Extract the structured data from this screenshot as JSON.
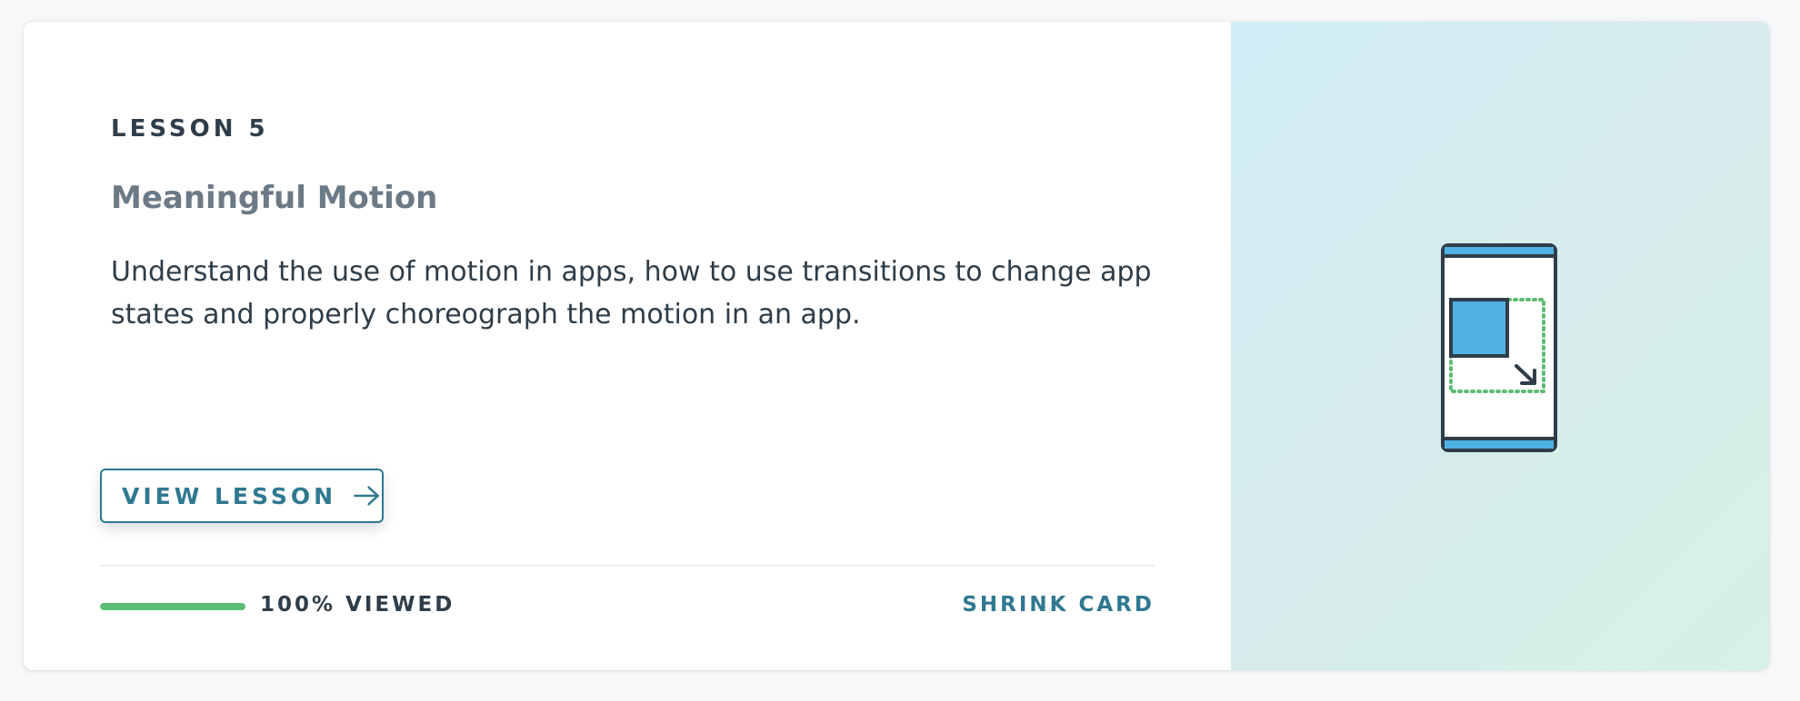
{
  "lesson": {
    "label": "LESSON 5",
    "title": "Meaningful Motion",
    "description": "Understand the use of motion in apps, how to use transitions to change app states and properly choreograph the motion in an app."
  },
  "actions": {
    "view_lesson_label": "VIEW LESSON",
    "view_lesson_icon": "arrow-right-icon",
    "shrink_label": "SHRINK CARD"
  },
  "progress": {
    "percent": 100,
    "text": "100% VIEWED"
  },
  "illustration": {
    "icon": "phone-motion-icon"
  },
  "colors": {
    "accent": "#2f7891",
    "progress": "#5cbd72",
    "text": "#2e3d49",
    "muted": "#6b7a86",
    "illustration_blue": "#4fb1e1",
    "illustration_green": "#5cbd72",
    "illustration_stroke": "#2e3d49"
  }
}
